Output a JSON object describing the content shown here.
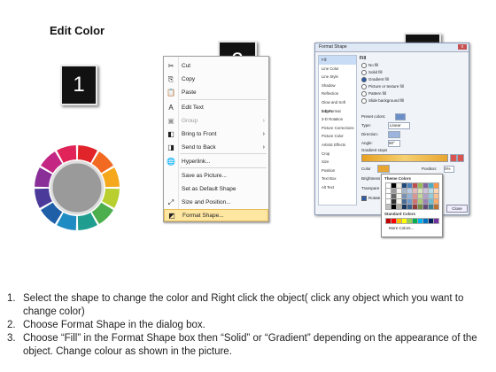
{
  "title": "Edit Color",
  "badges": {
    "one": "1",
    "two": "2",
    "three": "3"
  },
  "colors": {
    "ring": [
      "#e0242a",
      "#f26a21",
      "#f5a81c",
      "#b8cf2f",
      "#4cae4c",
      "#1f9e8f",
      "#1e8bc3",
      "#1f5fa8",
      "#4b3a9a",
      "#8a2f98",
      "#c42684",
      "#e0245a"
    ],
    "hub": "#9a9a9a",
    "badge": "#111111",
    "highlight": "#ffe7a2"
  },
  "context_menu": {
    "items": [
      {
        "icon": "scissors-icon",
        "glyph": "✂",
        "label": "Cut",
        "disabled": false,
        "submenu": false
      },
      {
        "icon": "copy-icon",
        "glyph": "⎘",
        "label": "Copy",
        "disabled": false,
        "submenu": false
      },
      {
        "icon": "paste-icon",
        "glyph": "📋",
        "label": "Paste",
        "disabled": false,
        "submenu": false
      },
      {
        "icon": "edit-text-icon",
        "glyph": "A",
        "label": "Edit Text",
        "disabled": false,
        "submenu": false
      },
      {
        "icon": "group-icon",
        "glyph": "▣",
        "label": "Group",
        "disabled": true,
        "submenu": true
      },
      {
        "icon": "bring-front-icon",
        "glyph": "◧",
        "label": "Bring to Front",
        "disabled": false,
        "submenu": true
      },
      {
        "icon": "send-back-icon",
        "glyph": "◨",
        "label": "Send to Back",
        "disabled": false,
        "submenu": true
      },
      {
        "icon": "hyperlink-icon",
        "glyph": "🌐",
        "label": "Hyperlink...",
        "disabled": false,
        "submenu": false
      },
      {
        "icon": "",
        "glyph": "",
        "label": "Save as Picture...",
        "disabled": false,
        "submenu": false
      },
      {
        "icon": "",
        "glyph": "",
        "label": "Set as Default Shape",
        "disabled": false,
        "submenu": false
      },
      {
        "icon": "size-position-icon",
        "glyph": "⤢",
        "label": "Size and Position...",
        "disabled": false,
        "submenu": false
      },
      {
        "icon": "format-shape-icon",
        "glyph": "◩",
        "label": "Format Shape...",
        "disabled": false,
        "submenu": false,
        "highlighted": true
      }
    ]
  },
  "dialog": {
    "title": "Format Shape",
    "close": "x",
    "categories": [
      "Fill",
      "Line Color",
      "Line Style",
      "Shadow",
      "Reflection",
      "Glow and Soft Edges",
      "3-D Format",
      "3-D Rotation",
      "Picture Corrections",
      "Picture Color",
      "Artistic Effects",
      "Crop",
      "Size",
      "Position",
      "Text Box",
      "Alt Text"
    ],
    "selected_category": "Fill",
    "section": "Fill",
    "fill_options": [
      {
        "label": "No fill",
        "on": false
      },
      {
        "label": "Solid fill",
        "on": false
      },
      {
        "label": "Gradient fill",
        "on": true
      },
      {
        "label": "Picture or texture fill",
        "on": false
      },
      {
        "label": "Pattern fill",
        "on": false
      },
      {
        "label": "Slide background fill",
        "on": false
      }
    ],
    "preset_label": "Preset colors:",
    "type_label": "Type:",
    "type_value": "Linear",
    "direction_label": "Direction:",
    "angle_label": "Angle:",
    "angle_value": "90°",
    "stops_label": "Gradient stops",
    "color_label": "Color",
    "position_label": "Position:",
    "position_value": "0%",
    "brightness_label": "Brightness",
    "transparency_label": "Transpare",
    "rotate_label": "Rotate",
    "close_label": "Close",
    "theme_label": "Theme Colors",
    "standard_label": "Standard Colors",
    "more_label": "More Colors...",
    "theme_colors": [
      "#ffffff",
      "#000000",
      "#eeece1",
      "#1f497d",
      "#4f81bd",
      "#c0504d",
      "#9bbb59",
      "#8064a2",
      "#4bacc6",
      "#f79646"
    ],
    "standard_colors": [
      "#c00000",
      "#ff0000",
      "#ffc000",
      "#ffff00",
      "#92d050",
      "#00b050",
      "#00b0f0",
      "#0070c0",
      "#002060",
      "#7030a0"
    ]
  },
  "steps": [
    {
      "num": "1.",
      "text": "Select the shape to change the color and Right click the object( click any object which you want to change color)"
    },
    {
      "num": "2.",
      "text": "Choose Format Shape in the dialog box."
    },
    {
      "num": "3.",
      "text": "Choose “Fill” in the Format Shape box then “Solid” or “Gradient” depending on the appearance of the object. Change colour as shown in the picture."
    }
  ]
}
